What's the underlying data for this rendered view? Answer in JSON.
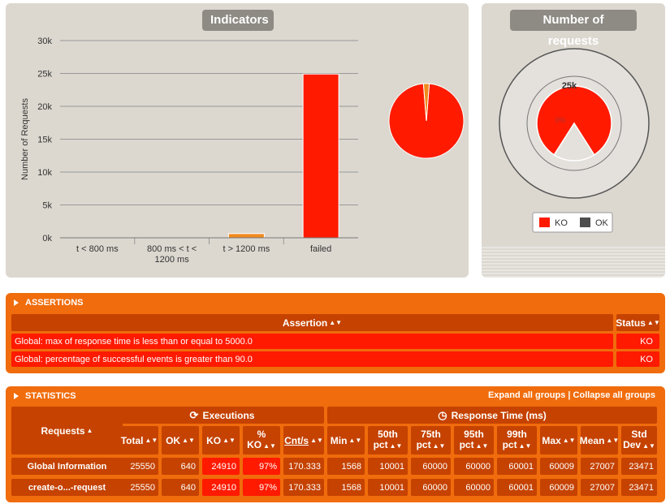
{
  "indicators": {
    "title": "Indicators",
    "chart_data": {
      "type": "bar",
      "ylabel": "Number of Requests",
      "ylim": [
        0,
        30000
      ],
      "yticks": [
        "0k",
        "5k",
        "10k",
        "15k",
        "20k",
        "25k",
        "30k"
      ],
      "categories": [
        "t < 800 ms",
        "800 ms < t < 1200 ms",
        "t > 1200 ms",
        "failed"
      ],
      "category_labels": [
        [
          "t < 800 ms"
        ],
        [
          "800 ms < t <",
          "1200 ms"
        ],
        [
          "t > 1200 ms"
        ],
        [
          "failed"
        ]
      ],
      "values": [
        0,
        0,
        640,
        24910
      ],
      "colors": [
        "#68b65c",
        "#ffdd00",
        "#f08a1e",
        "#ff1a00"
      ]
    },
    "pie": {
      "type": "pie",
      "values": [
        24910,
        640
      ],
      "colors": [
        "#ff1a00",
        "#f08a1e"
      ]
    }
  },
  "requests": {
    "title": "Number of requests",
    "chart_data": {
      "type": "pie",
      "label": "25k",
      "inner_label": "0%",
      "values": [
        24910,
        640
      ],
      "legend": [
        "KO",
        "OK"
      ],
      "colors": [
        "#ff1a00",
        "#4d4d4d"
      ]
    }
  },
  "assertions": {
    "header": "ASSERTIONS",
    "col_assertion": "Assertion",
    "col_status": "Status",
    "rows": [
      {
        "text": "Global: max of response time is less than or equal to 5000.0",
        "status": "KO"
      },
      {
        "text": "Global: percentage of successful events is greater than 90.0",
        "status": "KO"
      }
    ]
  },
  "statistics": {
    "header": "STATISTICS",
    "expand_all": "Expand all groups",
    "separator": "|",
    "collapse_all": "Collapse all groups",
    "requests_col": "Requests",
    "executions": "Executions",
    "response_time": "Response Time (ms)",
    "columns": {
      "total": "Total",
      "ok": "OK",
      "ko": "KO",
      "pct_ko_1": "%",
      "pct_ko_2": "KO",
      "cnt": "Cnt/s",
      "min": "Min",
      "p50_1": "50th",
      "p50_2": "pct",
      "p75_1": "75th",
      "p75_2": "pct",
      "p95_1": "95th",
      "p95_2": "pct",
      "p99_1": "99th",
      "p99_2": "pct",
      "max": "Max",
      "mean": "Mean",
      "std_1": "Std",
      "std_2": "Dev"
    },
    "rows": [
      {
        "name": "Global Information",
        "total": "25550",
        "ok": "640",
        "ko": "24910",
        "pct_ko": "97%",
        "cnt": "170.333",
        "min": "1568",
        "p50": "10001",
        "p75": "60000",
        "p95": "60000",
        "p99": "60001",
        "max": "60009",
        "mean": "27007",
        "std": "23471"
      },
      {
        "name": "create-o...-request",
        "total": "25550",
        "ok": "640",
        "ko": "24910",
        "pct_ko": "97%",
        "cnt": "170.333",
        "min": "1568",
        "p50": "10001",
        "p75": "60000",
        "p95": "60000",
        "p99": "60001",
        "max": "60009",
        "mean": "27007",
        "std": "23471"
      }
    ]
  }
}
